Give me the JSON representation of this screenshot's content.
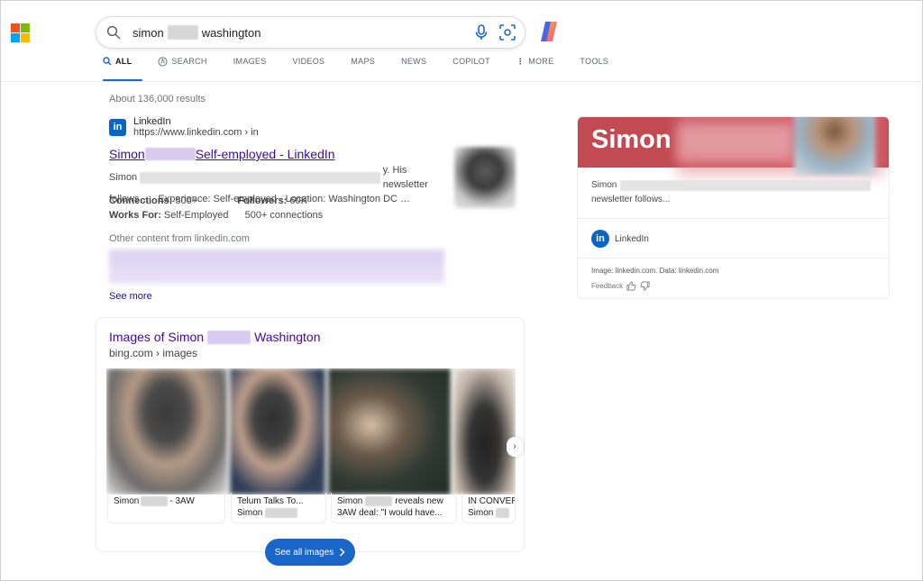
{
  "search": {
    "query_first": "simon",
    "query_last": "washington"
  },
  "tabs": [
    {
      "label": "ALL",
      "active": true
    },
    {
      "label": "SEARCH"
    },
    {
      "label": "IMAGES"
    },
    {
      "label": "VIDEOS"
    },
    {
      "label": "MAPS"
    },
    {
      "label": "NEWS"
    },
    {
      "label": "COPILOT"
    },
    {
      "label": "MORE"
    },
    {
      "label": "TOOLS"
    }
  ],
  "results_count": "About 136,000 results",
  "linkedin_result": {
    "site_name": "LinkedIn",
    "site_url": "https://www.linkedin.com › in",
    "title_first": "Simon",
    "title_rest": "Self-employed - LinkedIn",
    "snippet_start": "Simon",
    "snippet_end": "y. His newsletter",
    "snippet_line2": "follows… · Experience: Self-employed · Location: Washington DC …",
    "facts": {
      "connections_label": "Connections:",
      "connections_value": "500+",
      "followers_label": "Followers:",
      "followers_value": "60K",
      "worksfor_label": "Works For:",
      "worksfor_value": "Self-Employed",
      "connections_extra": "500+ connections"
    },
    "other_content": "Other content from linkedin.com",
    "see_more": "See more"
  },
  "images_section": {
    "title_first": "Images of Simon",
    "title_last": "Washington",
    "source": "bing.com › images",
    "captions": [
      {
        "line1_a": "Simon",
        "line1_b": "- 3AW",
        "line2": ""
      },
      {
        "line1_a": "Telum Talks To...",
        "line1_b": "",
        "line2": "Simon"
      },
      {
        "line1_a": "Simon",
        "line1_b": "reveals new",
        "line2": "3AW deal: \"I would have..."
      },
      {
        "line1_a": "IN CONVER",
        "line1_b": "",
        "line2": "Simon"
      }
    ],
    "see_all": "See all images"
  },
  "knowledge_panel": {
    "name": "Simon",
    "snippet_start": "Simon",
    "snippet_line2": "newsletter follows...",
    "source_name": "LinkedIn",
    "credit": "Image: linkedin.com. Data: linkedin.com",
    "feedback": "Feedback"
  },
  "colors": {
    "accent_blue": "#1a66c8",
    "link_purple": "#4007a2",
    "linkedin_blue": "#0a66c2",
    "kp_hero": "#c24a52"
  }
}
